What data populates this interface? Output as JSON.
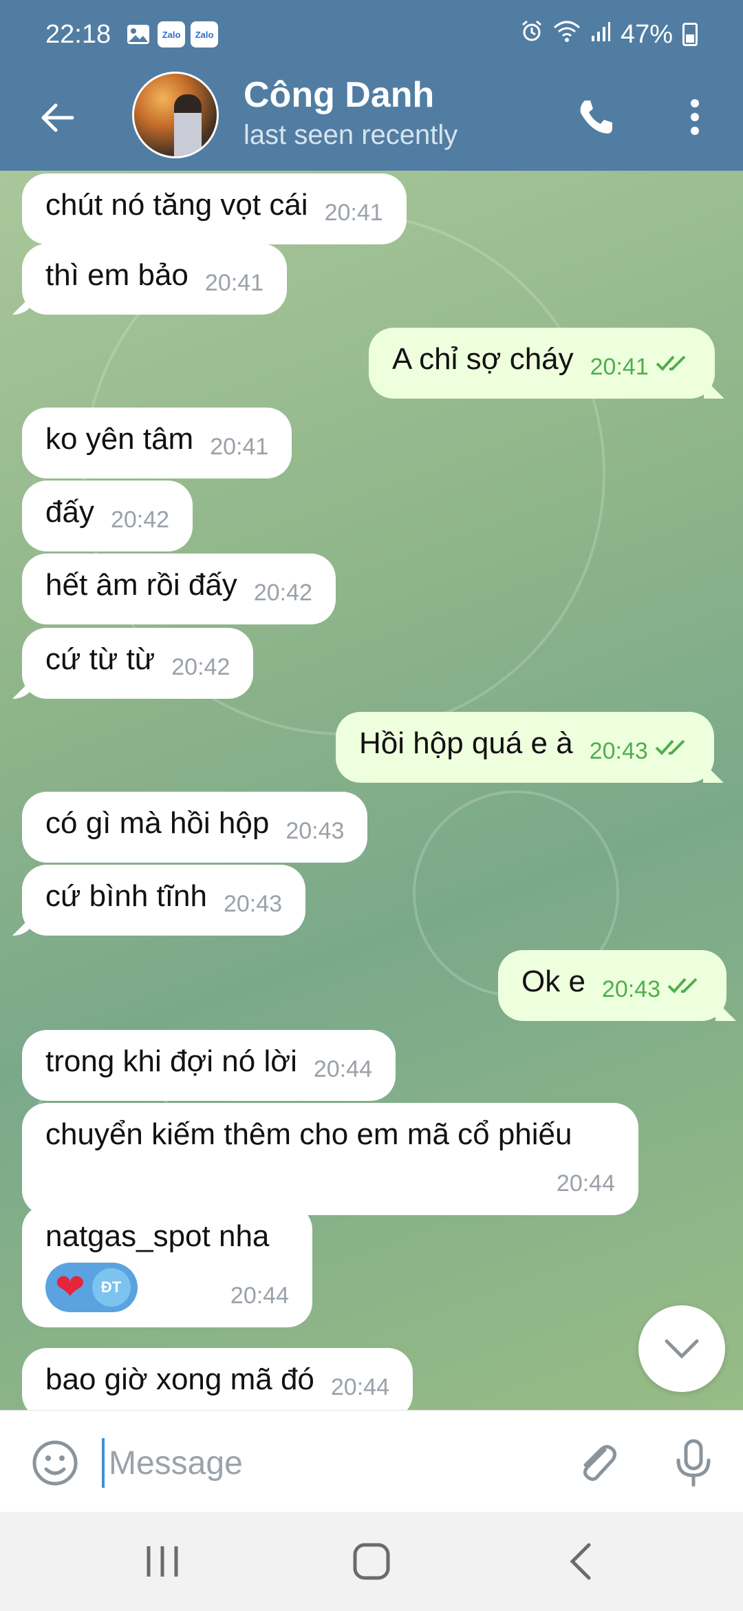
{
  "status_bar": {
    "time": "22:18",
    "notification_icons": [
      "image-icon",
      "zalo-icon",
      "zalo-icon"
    ],
    "zalo_label": "Zalo",
    "battery": "47%",
    "right_icons": [
      "alarm-icon",
      "wifi-icon",
      "signal-icon",
      "battery-icon"
    ]
  },
  "header": {
    "contact_name": "Công Danh",
    "contact_status": "last seen recently",
    "back_icon": "arrow-left-icon",
    "call_icon": "phone-icon",
    "menu_icon": "more-vertical-icon"
  },
  "messages": [
    {
      "dir": "in",
      "text": "chút nó tăng vọt cái",
      "time": "20:41"
    },
    {
      "dir": "in",
      "text": "thì em bảo",
      "time": "20:41"
    },
    {
      "dir": "out",
      "text": "A chỉ sợ cháy",
      "time": "20:41",
      "read": true
    },
    {
      "dir": "in",
      "text": "ko yên tâm",
      "time": "20:41"
    },
    {
      "dir": "in",
      "text": "đấy",
      "time": "20:42"
    },
    {
      "dir": "in",
      "text": "hết âm rồi đấy",
      "time": "20:42"
    },
    {
      "dir": "in",
      "text": "cứ từ từ",
      "time": "20:42"
    },
    {
      "dir": "out",
      "text": "Hồi hộp quá e à",
      "time": "20:43",
      "read": true
    },
    {
      "dir": "in",
      "text": "có gì mà hồi hộp",
      "time": "20:43"
    },
    {
      "dir": "in",
      "text": "cứ bình tĩnh",
      "time": "20:43"
    },
    {
      "dir": "out",
      "text": "Ok e",
      "time": "20:43",
      "read": true
    },
    {
      "dir": "in",
      "text": "trong khi đợi nó lời",
      "time": "20:44"
    },
    {
      "dir": "in",
      "text": "chuyển kiếm thêm cho em mã cổ phiếu",
      "time": "20:44"
    },
    {
      "dir": "in",
      "text": "natgas_spot nha",
      "time": "20:44",
      "reaction": "❤",
      "reactor_initials": "ĐT"
    },
    {
      "dir": "in",
      "text": "bao giờ xong mã đó",
      "time": "20:44"
    }
  ],
  "input": {
    "placeholder": "Message",
    "emoji_icon": "smile-icon",
    "attach_icon": "paperclip-icon",
    "mic_icon": "microphone-icon"
  },
  "scroll_down_icon": "chevron-down-icon",
  "nav": [
    "recents-icon",
    "home-icon",
    "back-icon"
  ],
  "colors": {
    "header_bg": "#517da2",
    "incoming_bubble": "#ffffff",
    "outgoing_bubble": "#eeffde",
    "outgoing_time": "#4fae4e",
    "accent": "#3d8fd6"
  }
}
